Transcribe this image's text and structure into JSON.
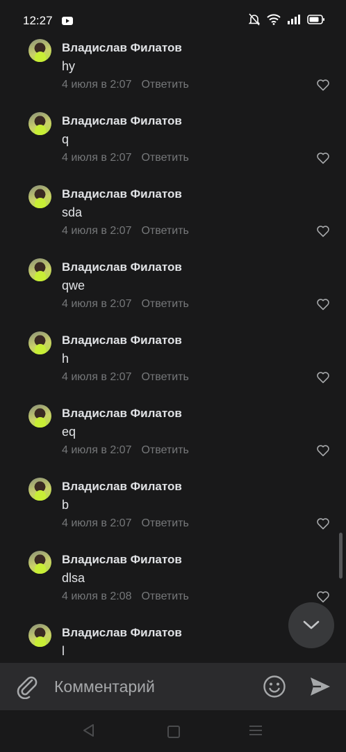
{
  "status_bar": {
    "time": "12:27"
  },
  "comments": [
    {
      "author": "Владислав Филатов",
      "text": "hy",
      "date": "4 июля в 2:07",
      "reply": "Ответить"
    },
    {
      "author": "Владислав Филатов",
      "text": "q",
      "date": "4 июля в 2:07",
      "reply": "Ответить"
    },
    {
      "author": "Владислав Филатов",
      "text": "sda",
      "date": "4 июля в 2:07",
      "reply": "Ответить"
    },
    {
      "author": "Владислав Филатов",
      "text": "qwe",
      "date": "4 июля в 2:07",
      "reply": "Ответить"
    },
    {
      "author": "Владислав Филатов",
      "text": "h",
      "date": "4 июля в 2:07",
      "reply": "Ответить"
    },
    {
      "author": "Владислав Филатов",
      "text": "eq",
      "date": "4 июля в 2:07",
      "reply": "Ответить"
    },
    {
      "author": "Владислав Филатов",
      "text": "b",
      "date": "4 июля в 2:07",
      "reply": "Ответить"
    },
    {
      "author": "Владислав Филатов",
      "text": "dlsa",
      "date": "4 июля в 2:08",
      "reply": "Ответить"
    },
    {
      "author": "Владислав Филатов",
      "text": "l",
      "date": "",
      "reply": ""
    }
  ],
  "composer": {
    "placeholder": "Комментарий"
  },
  "icons": {
    "attach": "paperclip-icon",
    "emoji": "smile-icon",
    "send": "send-icon",
    "scroll_down": "chevron-down-icon",
    "like": "heart-outline-icon"
  },
  "colors": {
    "background": "#19191a",
    "composer": "#2b2b2d",
    "meta_text": "#76787a"
  }
}
